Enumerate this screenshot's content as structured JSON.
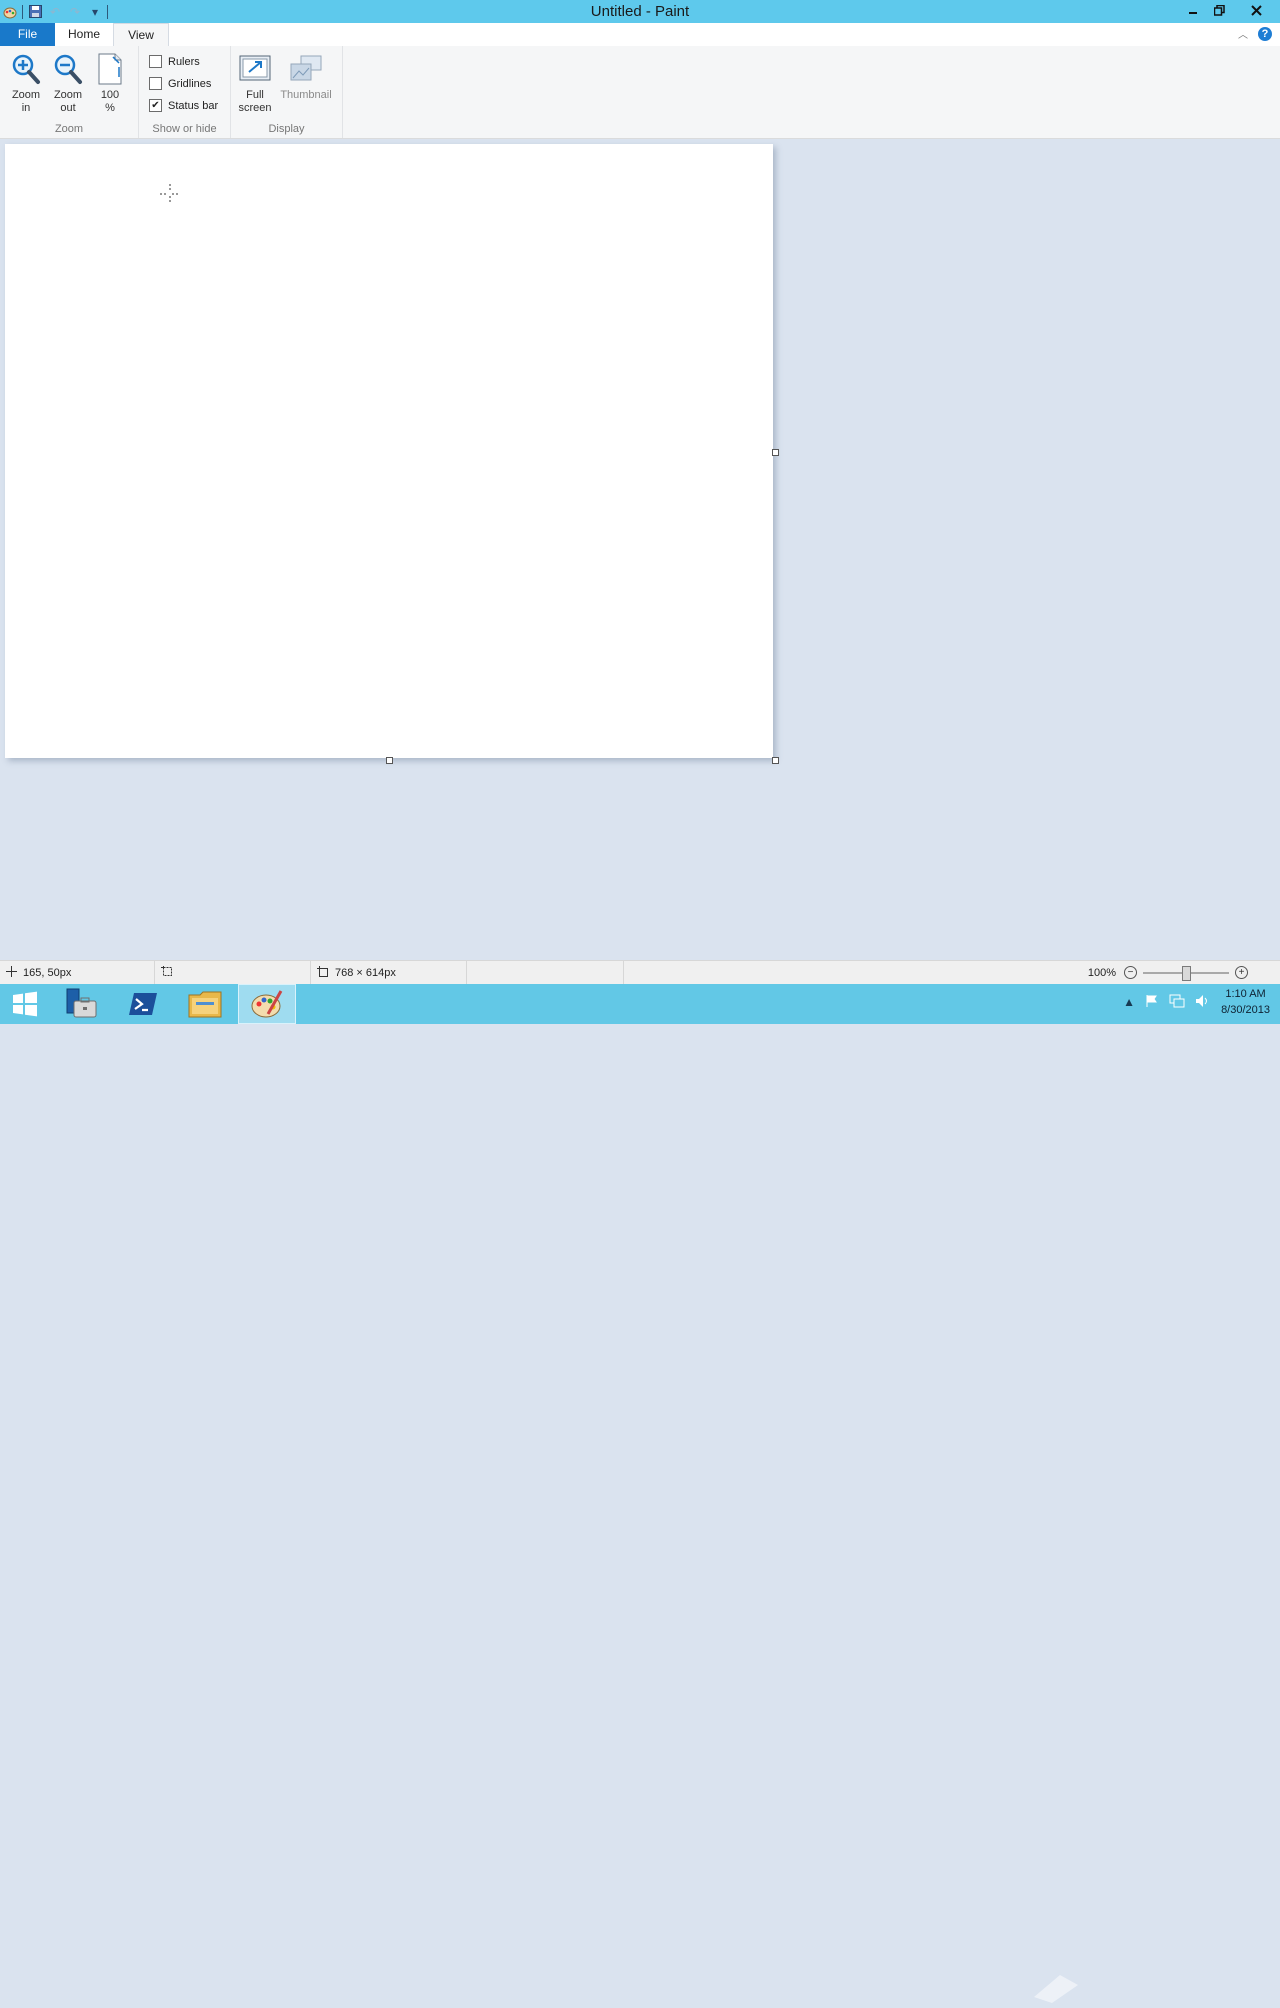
{
  "window": {
    "title": "Untitled - Paint"
  },
  "ribbon": {
    "tabs": [
      {
        "label": "File"
      },
      {
        "label": "Home"
      },
      {
        "label": "View"
      }
    ],
    "zoom_group": {
      "label": "Zoom",
      "zoom_in": {
        "line1": "Zoom",
        "line2": "in"
      },
      "zoom_out": {
        "line1": "Zoom",
        "line2": "out"
      },
      "hundred": {
        "line1": "100",
        "line2": "%"
      }
    },
    "show_hide_group": {
      "label": "Show or hide",
      "rulers": {
        "label": "Rulers",
        "checked": false
      },
      "gridlines": {
        "label": "Gridlines",
        "checked": false
      },
      "status_bar": {
        "label": "Status bar",
        "checked": true
      }
    },
    "display_group": {
      "label": "Display",
      "full_screen": {
        "line1": "Full",
        "line2": "screen"
      },
      "thumbnail": {
        "label": "Thumbnail"
      }
    }
  },
  "statusbar": {
    "cursor_position": "165, 50px",
    "selection_size": "",
    "image_size": "768 × 614px",
    "zoom_level": "100%",
    "zoom_fraction": 0.5
  },
  "taskbar": {
    "apps": [
      {
        "icon": "windows-logo-icon"
      },
      {
        "icon": "server-manager-icon"
      },
      {
        "icon": "powershell-icon"
      },
      {
        "icon": "file-explorer-icon"
      },
      {
        "icon": "paint-icon"
      }
    ],
    "clock": {
      "time": "1:10 AM",
      "date": "8/30/2013"
    }
  },
  "colors": {
    "titlebar": "#5ec9ec",
    "file_tab": "#1979ca",
    "taskbar": "#62c8e6",
    "workspace": "#dae3ef"
  }
}
